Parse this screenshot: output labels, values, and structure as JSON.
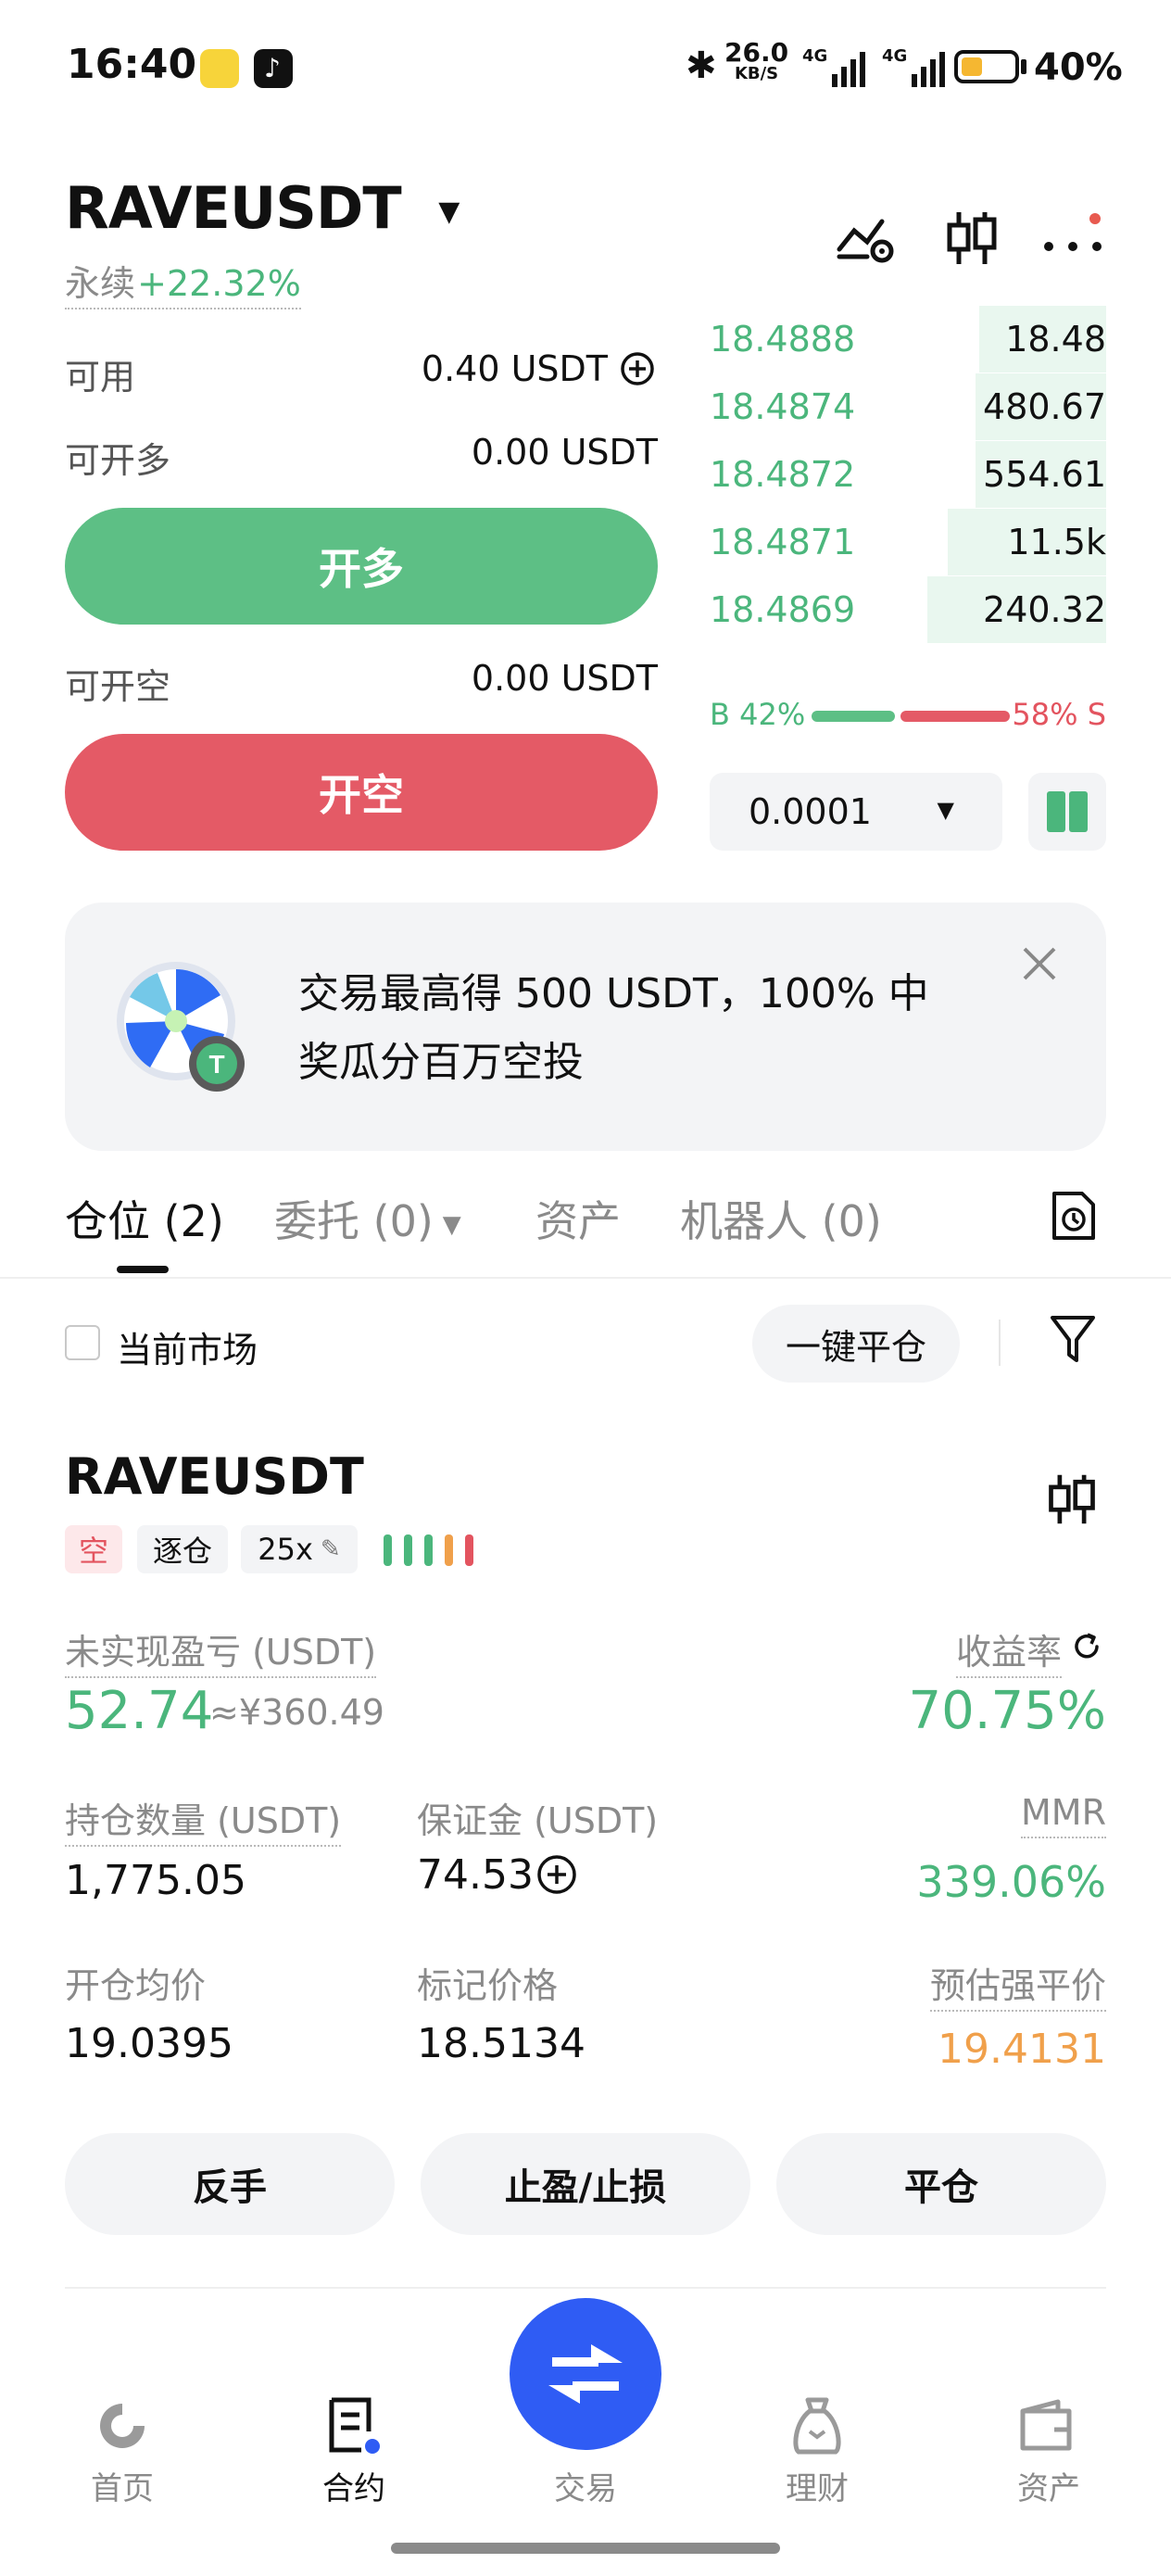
{
  "status_bar": {
    "time": "16:40",
    "net_speed": "26.0",
    "net_unit": "KB/S",
    "sim1": "4G",
    "sim2": "4G",
    "battery": "40%",
    "battery_level": 0.4
  },
  "header": {
    "pair": "RAVEUSDT",
    "contract_type": "永续",
    "change": "+22.32%"
  },
  "trade_panel": {
    "available_label": "可用",
    "available_value": "0.40 USDT",
    "open_long_label": "可开多",
    "open_long_value": "0.00 USDT",
    "long_button": "开多",
    "open_short_label": "可开空",
    "open_short_value": "0.00 USDT",
    "short_button": "开空"
  },
  "order_book": {
    "rows": [
      {
        "price": "18.4888",
        "qty": "18.48",
        "depth": 0.27
      },
      {
        "price": "18.4874",
        "qty": "480.67",
        "depth": 0.28
      },
      {
        "price": "18.4872",
        "qty": "554.61",
        "depth": 0.28
      },
      {
        "price": "18.4871",
        "qty": "11.5k",
        "depth": 0.35
      },
      {
        "price": "18.4869",
        "qty": "240.32",
        "depth": 0.4
      }
    ],
    "buy_ratio": "B 42%",
    "sell_ratio": "58% S",
    "buy_share": 0.42,
    "tick_size": "0.0001"
  },
  "banner": {
    "line1": "交易最高得 500 USDT，100% 中",
    "line2": "奖瓜分百万空投"
  },
  "tabs": [
    {
      "label": "仓位 (2)"
    },
    {
      "label": "委托 (0)"
    },
    {
      "label": "资产"
    },
    {
      "label": "机器人 (0)"
    }
  ],
  "filters": {
    "current_market": "当前市场",
    "close_all": "一键平仓"
  },
  "position": {
    "symbol": "RAVEUSDT",
    "side": "空",
    "margin_mode": "逐仓",
    "leverage": "25x",
    "unrealized_label": "未实现盈亏 (USDT)",
    "unrealized_value": "52.74",
    "unrealized_cny": "≈¥360.49",
    "roi_label": "收益率",
    "roi_value": "70.75%",
    "size_label": "持仓数量 (USDT)",
    "size_value": "1,775.05",
    "margin_label": "保证金 (USDT)",
    "margin_value": "74.53",
    "mmr_label": "MMR",
    "mmr_value": "339.06%",
    "entry_label": "开仓均价",
    "entry_value": "19.0395",
    "mark_label": "标记价格",
    "mark_value": "18.5134",
    "liq_label": "预估强平价",
    "liq_value": "19.4131",
    "reverse_button": "反手",
    "tpsl_button": "止盈/止损",
    "close_button": "平仓"
  },
  "bottom_nav": [
    {
      "label": "首页"
    },
    {
      "label": "合约"
    },
    {
      "label": "交易"
    },
    {
      "label": "理财"
    },
    {
      "label": "资产"
    }
  ],
  "colors": {
    "green": "#4bb67c",
    "red": "#e3545f",
    "accent_blue": "#2f5cf4",
    "orange": "#f0a04b"
  }
}
